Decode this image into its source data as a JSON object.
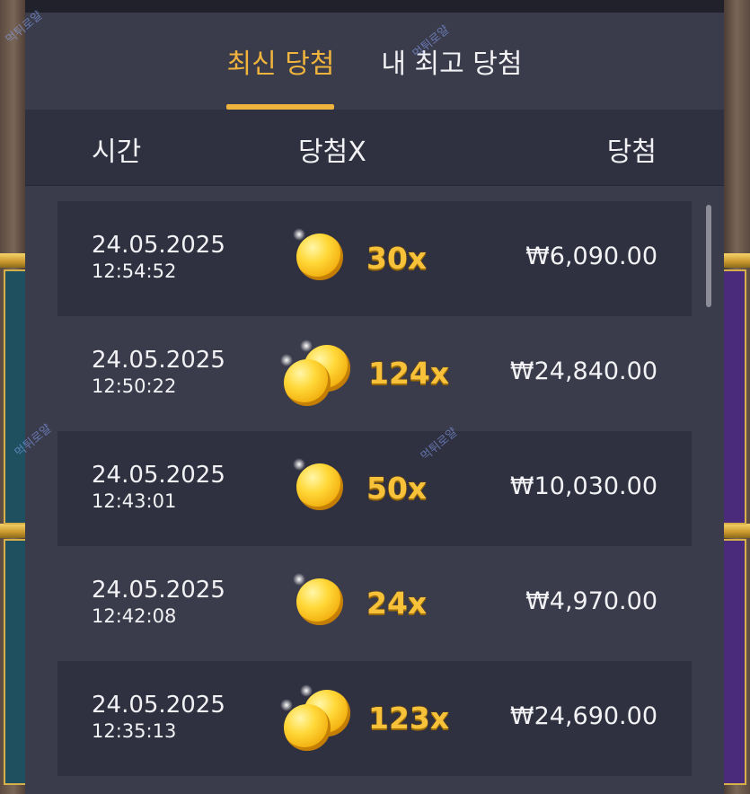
{
  "tabs": [
    {
      "label": "최신 당첨",
      "active": true
    },
    {
      "label": "내 최고 당첨",
      "active": false
    }
  ],
  "table": {
    "headers": {
      "time": "시간",
      "multiplier": "당첨X",
      "win": "당첨"
    },
    "rows": [
      {
        "date": "24.05.2025",
        "time": "12:54:52",
        "multiplier": "30x",
        "amount": "₩6,090.00",
        "coins": 1
      },
      {
        "date": "24.05.2025",
        "time": "12:50:22",
        "multiplier": "124x",
        "amount": "₩24,840.00",
        "coins": 2
      },
      {
        "date": "24.05.2025",
        "time": "12:43:01",
        "multiplier": "50x",
        "amount": "₩10,030.00",
        "coins": 1
      },
      {
        "date": "24.05.2025",
        "time": "12:42:08",
        "multiplier": "24x",
        "amount": "₩4,970.00",
        "coins": 1
      },
      {
        "date": "24.05.2025",
        "time": "12:35:13",
        "multiplier": "123x",
        "amount": "₩24,690.00",
        "coins": 2
      }
    ]
  },
  "watermark": "먹튀로얄",
  "colors": {
    "accent": "#f0b43c",
    "panel": "#3a3b4b",
    "row_shaded": "#2f3040",
    "multiplier": "#f7c23a"
  }
}
